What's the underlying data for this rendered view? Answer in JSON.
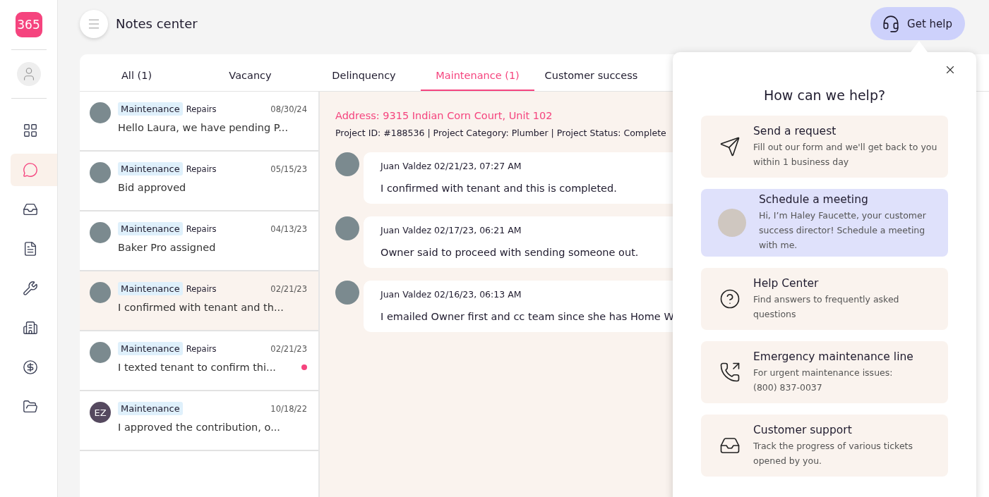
{
  "logo": "365",
  "sidebar": {
    "items": [
      {
        "selected": false
      },
      {
        "selected": true
      },
      {
        "selected": false
      },
      {
        "selected": false
      },
      {
        "selected": false
      },
      {
        "selected": false
      },
      {
        "selected": false
      },
      {
        "selected": false
      }
    ]
  },
  "header": {
    "title": "Notes center",
    "help_button": "Get help"
  },
  "tabs": [
    {
      "label": "All (1)",
      "selected": false
    },
    {
      "label": "Vacancy",
      "selected": false
    },
    {
      "label": "Delinquency",
      "selected": false
    },
    {
      "label": "Maintenance (1)",
      "selected": true
    },
    {
      "label": "Customer success",
      "selected": false
    }
  ],
  "notes": [
    {
      "avatar": {
        "kind": "photo"
      },
      "tag": "Maintenance",
      "subtag": "Repairs",
      "date": "08/30/24",
      "preview": "Hello Laura, we have pending P...",
      "selected": false,
      "unread": false
    },
    {
      "avatar": {
        "kind": "photo"
      },
      "tag": "Maintenance",
      "subtag": "Repairs",
      "date": "05/15/23",
      "preview": "Bid approved",
      "selected": false,
      "unread": false
    },
    {
      "avatar": {
        "kind": "photo"
      },
      "tag": "Maintenance",
      "subtag": "Repairs",
      "date": "04/13/23",
      "preview": "Baker Pro assigned",
      "selected": false,
      "unread": false
    },
    {
      "avatar": {
        "kind": "photo"
      },
      "tag": "Maintenance",
      "subtag": "Repairs",
      "date": "02/21/23",
      "preview": "I confirmed with tenant and th...",
      "selected": true,
      "unread": false
    },
    {
      "avatar": {
        "kind": "photo"
      },
      "tag": "Maintenance",
      "subtag": "Repairs",
      "date": "02/21/23",
      "preview": "I texted tenant to confirm thi...",
      "selected": false,
      "unread": true
    },
    {
      "avatar": {
        "kind": "initials",
        "initials": "EZ"
      },
      "tag": "Maintenance",
      "date": "10/18/22",
      "preview": "I approved the contribution, o...",
      "selected": false,
      "unread": false
    }
  ],
  "detail": {
    "address": "Address: 9315 Indian Corn Court, Unit 102",
    "project_info": "Project ID: #188536 | Project Category: Plumber | Project Status: Complete",
    "messages": [
      {
        "author": "Juan Valdez",
        "time": "02/21/23, 07:27 AM",
        "text": "I confirmed with tenant and this is completed."
      },
      {
        "author": "Juan Valdez",
        "time": "02/17/23, 06:21 AM",
        "text": "Owner said to proceed with sending someone out."
      },
      {
        "author": "Juan Valdez",
        "time": "02/16/23, 06:13 AM",
        "text": "I emailed Owner first and cc team since she has Home W"
      }
    ]
  },
  "help_popover": {
    "title": "How can we help?",
    "options": [
      {
        "kind": "icon",
        "title": "Send a request",
        "description": "Fill out our form and we'll get back to you within 1 business day",
        "highlighted": false
      },
      {
        "kind": "photo",
        "title": "Schedule a meeting",
        "description": "Hi, I’m Haley Faucette, your customer success director! Schedule a meeting with me.",
        "highlighted": true
      },
      {
        "kind": "icon",
        "title": "Help Center",
        "description": "Find answers to frequently asked questions",
        "highlighted": false
      },
      {
        "kind": "icon",
        "title": "Emergency maintenance line",
        "description": "For urgent maintenance issues:",
        "phone": "(800) 837-0037",
        "highlighted": false
      },
      {
        "kind": "icon",
        "title": "Customer support",
        "description": "Track the progress of various tickets opened by you.",
        "highlighted": false
      }
    ]
  }
}
